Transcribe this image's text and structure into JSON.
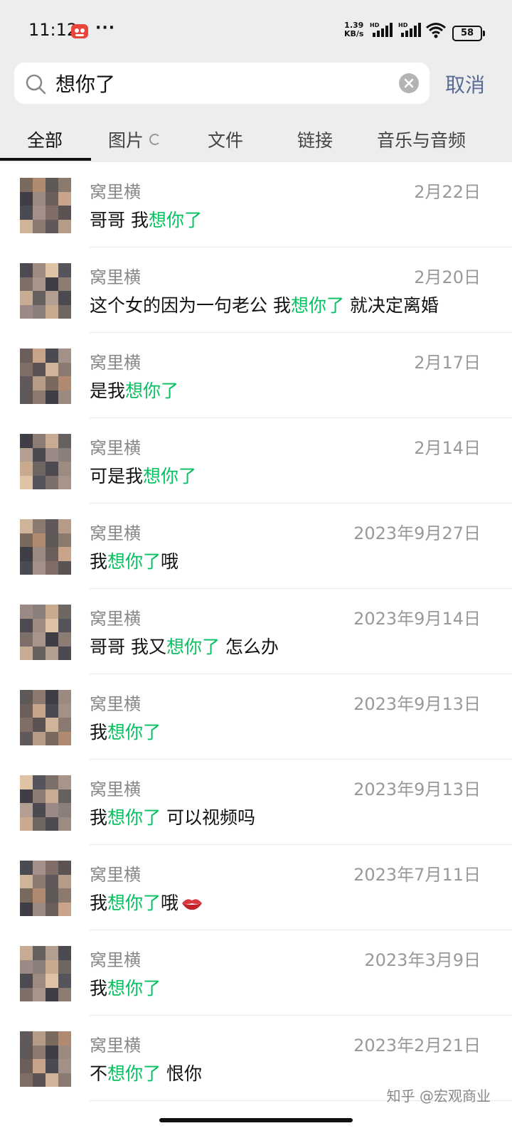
{
  "status_bar": {
    "time": "11:12",
    "more": "···",
    "net_speed_value": "1.39",
    "net_speed_unit": "KB/s",
    "signal1_label": "HD",
    "signal2_label": "HD",
    "battery": "58"
  },
  "search": {
    "query": "想你了",
    "cancel_label": "取消"
  },
  "tabs": [
    {
      "label": "全部"
    },
    {
      "label": "图片"
    },
    {
      "label": "文件"
    },
    {
      "label": "链接"
    },
    {
      "label": "音乐与音频"
    }
  ],
  "results": [
    {
      "sender": "窝里横",
      "date": "2月22日",
      "before": "哥哥 我",
      "match": "想你了",
      "after": ""
    },
    {
      "sender": "窝里横",
      "date": "2月20日",
      "before": "这个女的因为一句老公 我",
      "match": "想你了",
      "after": " 就决定离婚"
    },
    {
      "sender": "窝里横",
      "date": "2月17日",
      "before": "是我",
      "match": "想你了",
      "after": ""
    },
    {
      "sender": "窝里横",
      "date": "2月14日",
      "before": "可是我",
      "match": "想你了",
      "after": ""
    },
    {
      "sender": "窝里横",
      "date": "2023年9月27日",
      "before": "我",
      "match": "想你了",
      "after": "哦"
    },
    {
      "sender": "窝里横",
      "date": "2023年9月14日",
      "before": "哥哥 我又",
      "match": "想你了",
      "after": " 怎么办"
    },
    {
      "sender": "窝里横",
      "date": "2023年9月13日",
      "before": "我",
      "match": "想你了",
      "after": ""
    },
    {
      "sender": "窝里横",
      "date": "2023年9月13日",
      "before": "我",
      "match": "想你了",
      "after": " 可以视频吗"
    },
    {
      "sender": "窝里横",
      "date": "2023年7月11日",
      "before": "我",
      "match": "想你了",
      "after": "哦"
    },
    {
      "sender": "窝里横",
      "date": "2023年3月9日",
      "before": "我",
      "match": "想你了",
      "after": ""
    },
    {
      "sender": "窝里横",
      "date": "2023年2月21日",
      "before": "不",
      "match": "想你了",
      "after": " 恨你"
    }
  ],
  "watermark": "知乎 @宏观商业",
  "colors": {
    "highlight": "#07c160",
    "cancel": "#576b95",
    "header_bg": "#ededed"
  }
}
